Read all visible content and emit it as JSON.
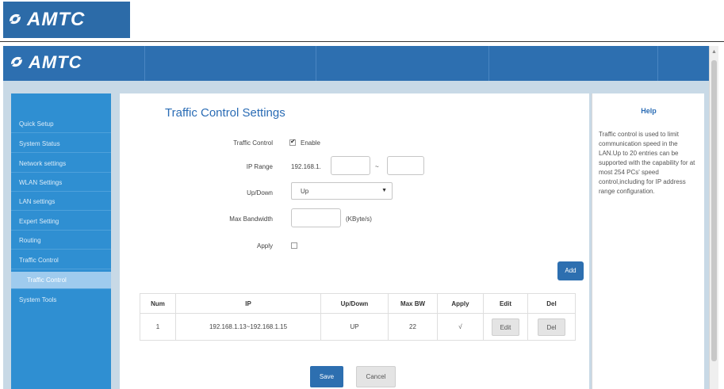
{
  "brand": {
    "name": "AMTC"
  },
  "sidebar": {
    "items": [
      {
        "label": "Quick Setup"
      },
      {
        "label": "System Status"
      },
      {
        "label": "Network settings"
      },
      {
        "label": "WLAN Settings"
      },
      {
        "label": "LAN settings"
      },
      {
        "label": "Expert Setting"
      },
      {
        "label": "Routing"
      },
      {
        "label": "Traffic Control"
      },
      {
        "label": "Traffic Control"
      },
      {
        "label": "System Tools"
      }
    ]
  },
  "main": {
    "title": "Traffic Control Settings",
    "form": {
      "traffic_control_label": "Traffic Control",
      "enable_label": "Enable",
      "enable_checked": true,
      "ip_range_label": "IP Range",
      "ip_prefix": "192.168.1.",
      "ip_start": "",
      "ip_sep": "~",
      "ip_end": "",
      "updown_label": "Up/Down",
      "updown_value": "Up",
      "max_bw_label": "Max Bandwidth",
      "max_bw_value": "",
      "max_bw_unit": "(KByte/s)",
      "apply_label": "Apply",
      "apply_checked": false
    },
    "add_label": "Add",
    "table": {
      "headers": [
        "Num",
        "IP",
        "Up/Down",
        "Max BW",
        "Apply",
        "Edit",
        "Del"
      ],
      "rows": [
        {
          "num": "1",
          "ip": "192.168.1.13~192.168.1.15",
          "updown": "UP",
          "max_bw": "22",
          "apply": "√",
          "edit": "Edit",
          "del": "Del"
        }
      ]
    },
    "save_label": "Save",
    "cancel_label": "Cancel"
  },
  "help": {
    "title": "Help",
    "text": "Traffic control is used to limit communication speed in the LAN.Up to 20 entries can be supported with the capability for at most 254 PCs' speed control,including for IP address range configuration."
  },
  "colors": {
    "accent": "#2d6fb0",
    "sidebar": "#2f8fd2",
    "sidebar_active": "#9fcbee"
  }
}
